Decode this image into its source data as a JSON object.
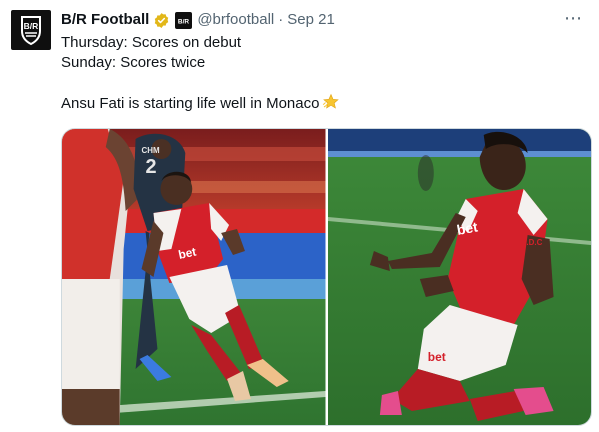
{
  "account": {
    "name": "B/R Football",
    "handle": "@brfootball",
    "separator": "·",
    "date": "Sep 21",
    "avatar_text": "B/R",
    "affiliate_text": "B/R",
    "verified_color": "#e2b719"
  },
  "tweet": {
    "lines": [
      "Thursday: Scores on debut",
      "Sunday: Scores twice",
      "",
      "Ansu Fati is starting life well in Monaco"
    ]
  },
  "more_icon": "⋯",
  "photo_left": {
    "shirt_sponsor": "bet",
    "opponent_number": "2",
    "opponent_name": "CHM"
  },
  "photo_right": {
    "shirt_sponsor": "bet",
    "sleeve_text": "R.D.C"
  },
  "colors": {
    "monaco_red": "#d4202a",
    "pitch_green": "#3f8f3c",
    "muted": "#536471"
  }
}
